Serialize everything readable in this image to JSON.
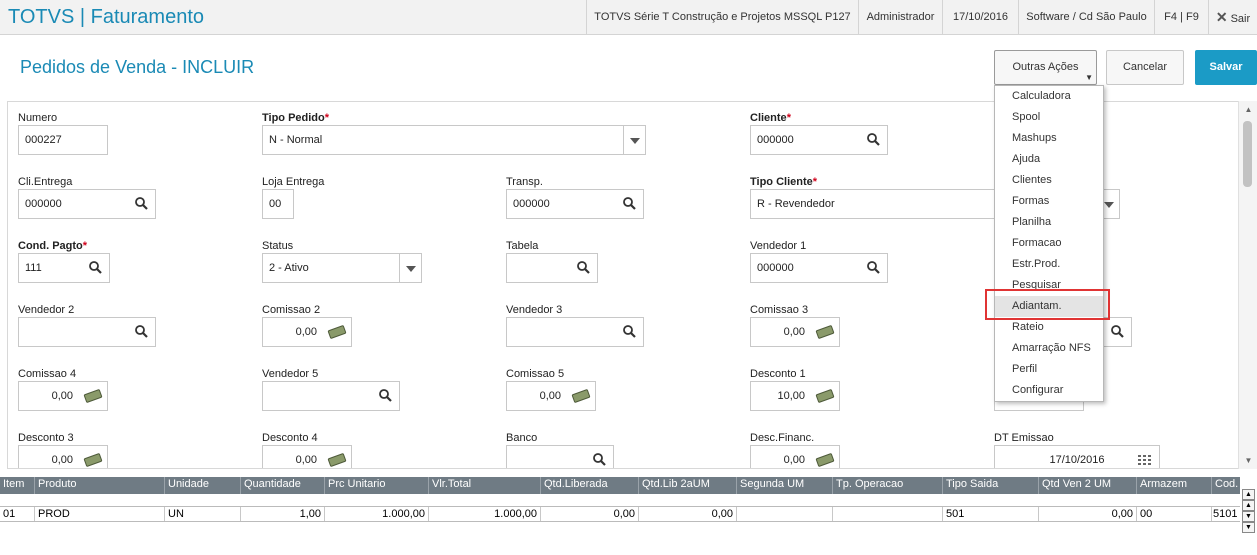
{
  "topbar": {
    "app_title": "TOTVS | Faturamento",
    "environment": "TOTVS Série T Construção e Projetos MSSQL P127",
    "user": "Administrador",
    "date": "17/10/2016",
    "company": "Software / Cd São Paulo",
    "shortcuts": "F4 | F9",
    "close_label": "Sair"
  },
  "header": {
    "title": "Pedidos de Venda - INCLUIR",
    "outras_acoes": "Outras Ações",
    "cancelar": "Cancelar",
    "salvar": "Salvar"
  },
  "menu": {
    "items": [
      "Calculadora",
      "Spool",
      "Mashups",
      "Ajuda",
      "Clientes",
      "Formas",
      "Planilha",
      "Formacao",
      "Estr.Prod.",
      "Pesquisar",
      "Adiantam.",
      "Rateio",
      "Amarração NFS",
      "Perfil",
      "Configurar"
    ],
    "highlighted": "Adiantam."
  },
  "form": {
    "numero": {
      "label": "Numero",
      "value": "000227"
    },
    "tipo_pedido": {
      "label": "Tipo Pedido",
      "value": "N - Normal"
    },
    "cliente": {
      "label": "Cliente",
      "value": "000000"
    },
    "cli_entrega": {
      "label": "Cli.Entrega",
      "value": "000000"
    },
    "loja_entrega": {
      "label": "Loja Entrega",
      "value": "00"
    },
    "transp": {
      "label": "Transp.",
      "value": "000000"
    },
    "tipo_cliente": {
      "label": "Tipo Cliente",
      "value": "R - Revendedor"
    },
    "cond_pagto": {
      "label": "Cond. Pagto",
      "value": "111"
    },
    "status": {
      "label": "Status",
      "value": "2 - Ativo"
    },
    "tabela": {
      "label": "Tabela",
      "value": ""
    },
    "vendedor1": {
      "label": "Vendedor 1",
      "value": "000000"
    },
    "vendedor2": {
      "label": "Vendedor 2",
      "value": ""
    },
    "comissao2": {
      "label": "Comissao 2",
      "value": "0,00"
    },
    "vendedor3": {
      "label": "Vendedor 3",
      "value": ""
    },
    "comissao3": {
      "label": "Comissao 3",
      "value": "0,00"
    },
    "comissao4": {
      "label": "Comissao 4",
      "value": "0,00"
    },
    "vendedor5": {
      "label": "Vendedor 5",
      "value": ""
    },
    "comissao5": {
      "label": "Comissao 5",
      "value": "0,00"
    },
    "desconto1": {
      "label": "Desconto 1",
      "value": "10,00"
    },
    "desconto3": {
      "label": "Desconto 3",
      "value": "0,00"
    },
    "desconto4": {
      "label": "Desconto 4",
      "value": "0,00"
    },
    "banco": {
      "label": "Banco",
      "value": ""
    },
    "desc_financ": {
      "label": "Desc.Financ.",
      "value": "0,00"
    },
    "dt_emissao": {
      "label": "DT Emissao",
      "value": "17/10/2016"
    },
    "required_mark": "*"
  },
  "grid": {
    "columns": [
      "Item",
      "Produto",
      "Unidade",
      "Quantidade",
      "Prc Unitario",
      "Vlr.Total",
      "Qtd.Liberada",
      "Qtd.Lib 2aUM",
      "Segunda UM",
      "Tp. Operacao",
      "Tipo Saida",
      "Qtd Ven 2 UM",
      "Armazem",
      "Cod."
    ],
    "rows": [
      [
        "01",
        "PROD",
        "UN",
        "1,00",
        "1.000,00",
        "1.000,00",
        "0,00",
        "0,00",
        "",
        "",
        "501",
        "0,00",
        "00",
        "5101"
      ]
    ]
  },
  "icons": {
    "search": "search-icon",
    "money": "money-icon",
    "calendar": "calendar-icon",
    "dropdown": "chevron-down-icon",
    "close": "close-icon"
  },
  "colors": {
    "accent": "#1a8ab5",
    "primary_button": "#1b9bc6",
    "grid_header": "#6f7b84",
    "required": "#d0021b",
    "highlight_box": "#e03434"
  }
}
